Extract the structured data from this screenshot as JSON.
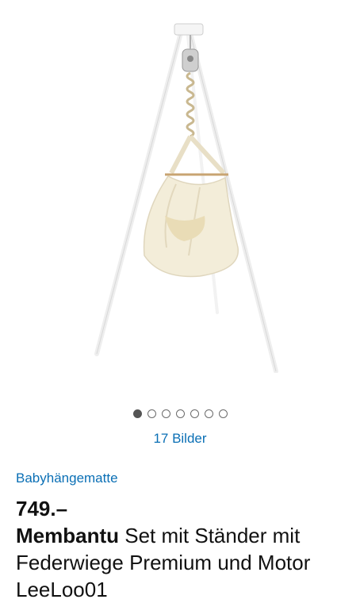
{
  "gallery": {
    "image_alt": "Membantu Babyhängematte mit Ständer",
    "image_count_label": "17 Bilder",
    "dots_total": 7,
    "active_dot": 0
  },
  "product": {
    "category": "Babyhängematte",
    "price": "749.–",
    "brand": "Membantu",
    "name": "Set mit Ständer mit Federwiege Premium und Motor LeeLoo01"
  },
  "colors": {
    "link": "#0a6fb5",
    "text": "#111111",
    "fabric": "#f3edd9"
  }
}
